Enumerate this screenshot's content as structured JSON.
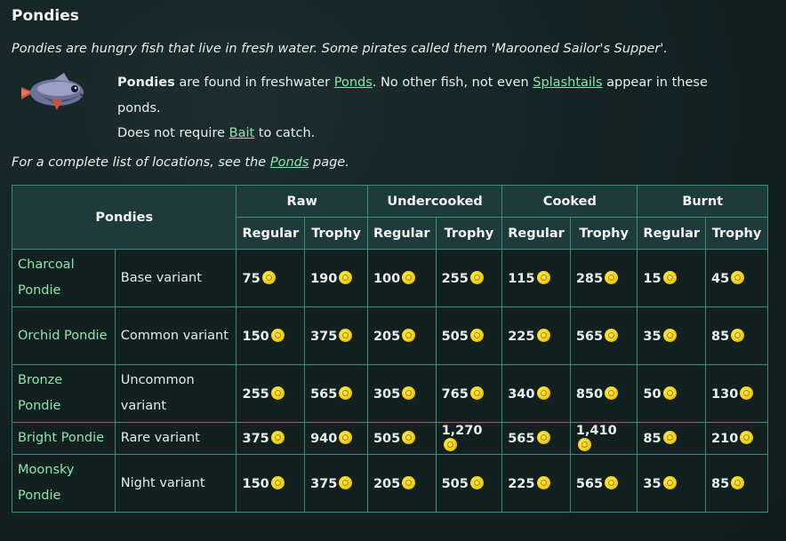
{
  "title": "Pondies",
  "intro": "Pondies are hungry fish that live in fresh water. Some pirates called them 'Marooned Sailor's Supper'.",
  "found": {
    "name": "Pondies",
    "t1": " are found in freshwater ",
    "link1": "Ponds",
    "t2": ". No other fish, not even ",
    "link2": "Splashtails",
    "t3": " appear in these ponds."
  },
  "bait": {
    "t1": "Does not require ",
    "link": "Bait",
    "t2": " to catch."
  },
  "locations": {
    "t1": "For a complete list of locations, see the ",
    "link": "Ponds",
    "t2": " page."
  },
  "table": {
    "corner": "Pondies",
    "groups": [
      "Raw",
      "Undercooked",
      "Cooked",
      "Burnt"
    ],
    "sub": [
      "Regular",
      "Trophy"
    ],
    "rows": [
      {
        "name": "Charcoal Pondie",
        "variant": "Base variant",
        "values": [
          "75",
          "190",
          "100",
          "255",
          "115",
          "285",
          "15",
          "45"
        ]
      },
      {
        "name": "Orchid Pondie",
        "variant": "Common variant",
        "values": [
          "150",
          "375",
          "205",
          "505",
          "225",
          "565",
          "35",
          "85"
        ]
      },
      {
        "name": "Bronze Pondie",
        "variant": "Uncommon variant",
        "values": [
          "255",
          "565",
          "305",
          "765",
          "340",
          "850",
          "50",
          "130"
        ]
      },
      {
        "name": "Bright Pondie",
        "variant": "Rare variant",
        "values": [
          "375",
          "940",
          "505",
          "1,270",
          "565",
          "1,410",
          "85",
          "210"
        ]
      },
      {
        "name": "Moonsky Pondie",
        "variant": "Night variant",
        "values": [
          "150",
          "375",
          "205",
          "505",
          "225",
          "565",
          "35",
          "85"
        ]
      }
    ]
  },
  "icons": {
    "fish": "pondie-fish-icon",
    "coin": "gold-coin-icon"
  },
  "colors": {
    "link": "#8fe3b3",
    "border": "#3c8b80",
    "coin": "#f2d21a"
  }
}
